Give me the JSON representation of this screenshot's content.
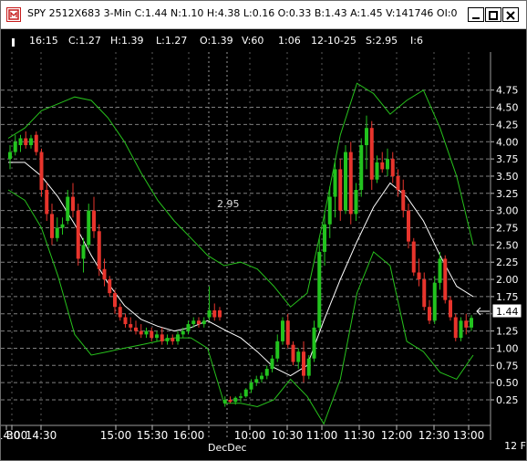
{
  "window": {
    "title": "SPY 2512X683 3-Min C:1.44 N:1.10 H:4.38 L:0.16 O:0.33 B:1.43 A:1.45 V:141746 OI:0"
  },
  "info_bar": {
    "time": "16:15",
    "close": "C:1.27",
    "high": "H:1.39",
    "low": "L:1.27",
    "open": "O:1.39",
    "volume": "V:60",
    "bar_time": "1:06",
    "date": "12-10-25",
    "spot": "S:2.95",
    "interval": "I:6"
  },
  "crosshair_label": "2.95",
  "current_price_label": "1.44",
  "day_separator_label": "DecDec",
  "corner_label": "12 F",
  "colors": {
    "up": "#22c31e",
    "down": "#e8342c",
    "band": "#27c21c",
    "average": "#ffffff",
    "grid": "#7f7f7f",
    "background": "#000000"
  },
  "chart_data": {
    "type": "candlestick",
    "yaxis_ticks": [
      "4.75",
      "4.50",
      "4.25",
      "4.00",
      "3.75",
      "3.50",
      "3.25",
      "3.00",
      "2.75",
      "2.50",
      "2.25",
      "2.00",
      "1.75",
      "1.50",
      "1.25",
      "1.00",
      "0.75",
      "0.50",
      "0.25"
    ],
    "xaxis_ticks": [
      "30",
      "14:00",
      "14:30",
      "15:00",
      "15:30",
      "16:00",
      "10:00",
      "10:30",
      "11:00",
      "11:30",
      "12:00",
      "12:30",
      "13:00"
    ],
    "ylim": [
      0,
      4.85
    ],
    "series": [
      {
        "name": "Upper band",
        "values": [
          4.05,
          4.2,
          4.45,
          4.55,
          4.65,
          4.6,
          4.35,
          4.0,
          3.55,
          3.15,
          2.85,
          2.6,
          2.35,
          2.2,
          2.25,
          2.15,
          1.9,
          1.6,
          1.8,
          2.9,
          4.1,
          4.85,
          4.7,
          4.4,
          4.6,
          4.75,
          4.2,
          3.5,
          2.5
        ]
      },
      {
        "name": "Average",
        "values": [
          3.7,
          3.7,
          3.5,
          3.2,
          2.8,
          2.35,
          1.95,
          1.62,
          1.42,
          1.32,
          1.25,
          1.3,
          1.4,
          1.27,
          1.15,
          0.95,
          0.72,
          0.6,
          0.75,
          1.4,
          2.0,
          2.55,
          3.05,
          3.4,
          3.2,
          2.85,
          2.35,
          1.9,
          1.75
        ]
      },
      {
        "name": "Lower band",
        "values": [
          3.3,
          3.15,
          2.75,
          2.05,
          1.2,
          0.9,
          0.95,
          1.0,
          1.05,
          1.1,
          1.15,
          1.15,
          1.0,
          0.2,
          0.2,
          0.15,
          0.25,
          0.55,
          0.3,
          -0.1,
          0.55,
          1.8,
          2.4,
          2.2,
          1.1,
          0.95,
          0.65,
          0.55,
          0.9
        ]
      }
    ],
    "candles": [
      {
        "o": 3.75,
        "h": 3.95,
        "l": 3.6,
        "c": 3.85
      },
      {
        "o": 3.85,
        "h": 4.1,
        "l": 3.8,
        "c": 4.0
      },
      {
        "o": 3.95,
        "h": 4.1,
        "l": 3.85,
        "c": 4.05
      },
      {
        "o": 4.05,
        "h": 4.15,
        "l": 3.9,
        "c": 3.95
      },
      {
        "o": 3.95,
        "h": 4.1,
        "l": 3.9,
        "c": 4.05
      },
      {
        "o": 4.1,
        "h": 4.15,
        "l": 3.8,
        "c": 3.85
      },
      {
        "o": 3.85,
        "h": 3.9,
        "l": 3.2,
        "c": 3.3
      },
      {
        "o": 3.3,
        "h": 3.4,
        "l": 2.85,
        "c": 2.95
      },
      {
        "o": 2.95,
        "h": 3.1,
        "l": 2.5,
        "c": 2.6
      },
      {
        "o": 2.6,
        "h": 2.9,
        "l": 2.55,
        "c": 2.75
      },
      {
        "o": 2.75,
        "h": 2.9,
        "l": 2.65,
        "c": 2.8
      },
      {
        "o": 2.85,
        "h": 3.3,
        "l": 2.8,
        "c": 3.2
      },
      {
        "o": 3.2,
        "h": 3.4,
        "l": 2.9,
        "c": 3.0
      },
      {
        "o": 3.0,
        "h": 3.1,
        "l": 2.2,
        "c": 2.3
      },
      {
        "o": 2.3,
        "h": 2.6,
        "l": 2.1,
        "c": 2.5
      },
      {
        "o": 2.5,
        "h": 3.1,
        "l": 2.45,
        "c": 3.0
      },
      {
        "o": 3.0,
        "h": 3.2,
        "l": 2.6,
        "c": 2.7
      },
      {
        "o": 2.7,
        "h": 2.8,
        "l": 2.05,
        "c": 2.15
      },
      {
        "o": 2.15,
        "h": 2.3,
        "l": 1.9,
        "c": 2.0
      },
      {
        "o": 2.0,
        "h": 2.05,
        "l": 1.75,
        "c": 1.8
      },
      {
        "o": 1.8,
        "h": 1.85,
        "l": 1.5,
        "c": 1.6
      },
      {
        "o": 1.6,
        "h": 1.65,
        "l": 1.4,
        "c": 1.45
      },
      {
        "o": 1.45,
        "h": 1.5,
        "l": 1.3,
        "c": 1.35
      },
      {
        "o": 1.35,
        "h": 1.45,
        "l": 1.25,
        "c": 1.3
      },
      {
        "o": 1.3,
        "h": 1.4,
        "l": 1.2,
        "c": 1.25
      },
      {
        "o": 1.25,
        "h": 1.35,
        "l": 1.15,
        "c": 1.2
      },
      {
        "o": 1.2,
        "h": 1.3,
        "l": 1.15,
        "c": 1.25
      },
      {
        "o": 1.25,
        "h": 1.3,
        "l": 1.1,
        "c": 1.15
      },
      {
        "o": 1.15,
        "h": 1.25,
        "l": 1.1,
        "c": 1.2
      },
      {
        "o": 1.2,
        "h": 1.3,
        "l": 1.05,
        "c": 1.1
      },
      {
        "o": 1.1,
        "h": 1.2,
        "l": 1.05,
        "c": 1.15
      },
      {
        "o": 1.15,
        "h": 1.2,
        "l": 1.05,
        "c": 1.1
      },
      {
        "o": 1.1,
        "h": 1.25,
        "l": 1.05,
        "c": 1.2
      },
      {
        "o": 1.2,
        "h": 1.3,
        "l": 1.15,
        "c": 1.25
      },
      {
        "o": 1.25,
        "h": 1.4,
        "l": 1.2,
        "c": 1.35
      },
      {
        "o": 1.35,
        "h": 1.45,
        "l": 1.3,
        "c": 1.4
      },
      {
        "o": 1.4,
        "h": 1.45,
        "l": 1.3,
        "c": 1.35
      },
      {
        "o": 1.35,
        "h": 1.45,
        "l": 1.3,
        "c": 1.4
      },
      {
        "o": 1.45,
        "h": 1.9,
        "l": 1.4,
        "c": 1.55
      },
      {
        "o": 1.55,
        "h": 1.65,
        "l": 1.4,
        "c": 1.45
      },
      {
        "o": 1.55,
        "h": 1.6,
        "l": 1.4,
        "c": 1.45
      },
      {
        "o": 0.2,
        "h": 0.3,
        "l": 0.15,
        "c": 0.25
      },
      {
        "o": 0.25,
        "h": 0.3,
        "l": 0.2,
        "c": 0.22
      },
      {
        "o": 0.22,
        "h": 0.3,
        "l": 0.18,
        "c": 0.28
      },
      {
        "o": 0.28,
        "h": 0.35,
        "l": 0.22,
        "c": 0.3
      },
      {
        "o": 0.3,
        "h": 0.42,
        "l": 0.28,
        "c": 0.4
      },
      {
        "o": 0.4,
        "h": 0.55,
        "l": 0.35,
        "c": 0.5
      },
      {
        "o": 0.5,
        "h": 0.6,
        "l": 0.45,
        "c": 0.55
      },
      {
        "o": 0.55,
        "h": 0.65,
        "l": 0.5,
        "c": 0.6
      },
      {
        "o": 0.6,
        "h": 0.75,
        "l": 0.55,
        "c": 0.7
      },
      {
        "o": 0.7,
        "h": 0.9,
        "l": 0.65,
        "c": 0.85
      },
      {
        "o": 0.85,
        "h": 1.2,
        "l": 0.8,
        "c": 1.1
      },
      {
        "o": 1.1,
        "h": 1.45,
        "l": 1.05,
        "c": 1.4
      },
      {
        "o": 1.4,
        "h": 1.5,
        "l": 1.0,
        "c": 1.05
      },
      {
        "o": 1.05,
        "h": 1.1,
        "l": 0.75,
        "c": 0.8
      },
      {
        "o": 0.8,
        "h": 1.0,
        "l": 0.7,
        "c": 0.95
      },
      {
        "o": 0.95,
        "h": 1.1,
        "l": 0.5,
        "c": 0.6
      },
      {
        "o": 0.6,
        "h": 0.9,
        "l": 0.55,
        "c": 0.85
      },
      {
        "o": 0.85,
        "h": 1.4,
        "l": 0.8,
        "c": 1.3
      },
      {
        "o": 1.3,
        "h": 2.6,
        "l": 1.25,
        "c": 2.4
      },
      {
        "o": 2.4,
        "h": 3.0,
        "l": 2.2,
        "c": 2.8
      },
      {
        "o": 2.8,
        "h": 3.35,
        "l": 2.6,
        "c": 3.2
      },
      {
        "o": 3.2,
        "h": 3.7,
        "l": 2.9,
        "c": 3.6
      },
      {
        "o": 3.6,
        "h": 3.75,
        "l": 2.85,
        "c": 3.0
      },
      {
        "o": 3.0,
        "h": 3.95,
        "l": 2.95,
        "c": 3.85
      },
      {
        "o": 3.85,
        "h": 4.0,
        "l": 2.8,
        "c": 2.95
      },
      {
        "o": 2.95,
        "h": 3.4,
        "l": 2.85,
        "c": 3.3
      },
      {
        "o": 3.3,
        "h": 4.05,
        "l": 3.2,
        "c": 3.95
      },
      {
        "o": 3.95,
        "h": 4.38,
        "l": 3.6,
        "c": 4.2
      },
      {
        "o": 4.2,
        "h": 4.3,
        "l": 3.3,
        "c": 3.45
      },
      {
        "o": 3.45,
        "h": 3.8,
        "l": 3.4,
        "c": 3.7
      },
      {
        "o": 3.7,
        "h": 3.85,
        "l": 3.55,
        "c": 3.6
      },
      {
        "o": 3.6,
        "h": 3.9,
        "l": 3.5,
        "c": 3.75
      },
      {
        "o": 3.75,
        "h": 3.85,
        "l": 3.4,
        "c": 3.5
      },
      {
        "o": 3.5,
        "h": 3.6,
        "l": 3.2,
        "c": 3.3
      },
      {
        "o": 3.3,
        "h": 3.45,
        "l": 2.9,
        "c": 3.0
      },
      {
        "o": 3.0,
        "h": 3.1,
        "l": 2.45,
        "c": 2.55
      },
      {
        "o": 2.55,
        "h": 2.6,
        "l": 2.05,
        "c": 2.1
      },
      {
        "o": 2.1,
        "h": 2.3,
        "l": 1.9,
        "c": 2.0
      },
      {
        "o": 2.0,
        "h": 2.1,
        "l": 1.55,
        "c": 1.6
      },
      {
        "o": 1.6,
        "h": 1.7,
        "l": 1.35,
        "c": 1.4
      },
      {
        "o": 1.4,
        "h": 2.05,
        "l": 1.35,
        "c": 1.95
      },
      {
        "o": 1.95,
        "h": 2.4,
        "l": 1.85,
        "c": 2.3
      },
      {
        "o": 2.3,
        "h": 2.35,
        "l": 1.65,
        "c": 1.7
      },
      {
        "o": 1.7,
        "h": 1.75,
        "l": 1.4,
        "c": 1.45
      },
      {
        "o": 1.45,
        "h": 1.5,
        "l": 1.1,
        "c": 1.15
      },
      {
        "o": 1.15,
        "h": 1.45,
        "l": 1.1,
        "c": 1.4
      },
      {
        "o": 1.4,
        "h": 1.5,
        "l": 1.2,
        "c": 1.3
      },
      {
        "o": 1.3,
        "h": 1.48,
        "l": 1.25,
        "c": 1.44
      }
    ]
  }
}
